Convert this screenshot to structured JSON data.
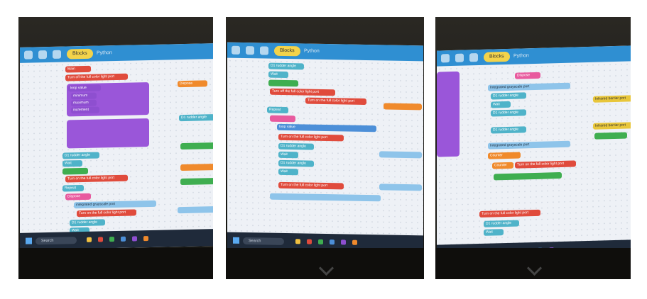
{
  "tabs": {
    "blocks": "Blocks",
    "python": "Python"
  },
  "taskbar": {
    "search": "Search"
  },
  "photo1": {
    "labels": [
      "Main",
      "Turn off the full color light port",
      "loop value",
      "min",
      "minimum",
      "maximum",
      "increment",
      "D1 rudder angle",
      "Wait",
      "Turn on the full color light port",
      "Repeat",
      "Dispose",
      "integrated grayscale port"
    ]
  },
  "photo2": {
    "labels": [
      "D1 rudder angle",
      "Wait",
      "Turn off the full color light port",
      "Turn on the full color light port",
      "Repeat",
      "loop value",
      "Integrated grayscale port",
      "D1 rudder angle",
      "Wait"
    ]
  },
  "photo3": {
    "labels": [
      "Dispose",
      "Integrated grayscale port",
      "D1 rudder angle",
      "Wait",
      "Counter",
      "Turn on the full color light port",
      "Infrared barrier port"
    ]
  }
}
